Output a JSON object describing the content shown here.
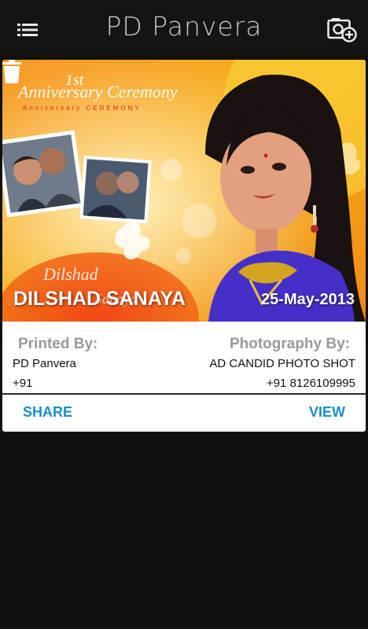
{
  "appbar": {
    "title": "PD Panvera",
    "menu_icon": "hamburger-menu-icon",
    "add_photo_icon": "add-photo-icon"
  },
  "card": {
    "image": {
      "ceremony_title": "1st Anniversary Ceremony",
      "ceremony_subtitle": "Anniversary CEREMONY",
      "couple_script": "Dilshad weds Sanaya",
      "name_overlay": "DILSHAD SANAYA",
      "date_overlay": "25-May-2013",
      "delete_icon": "trash-icon"
    },
    "printed_by": {
      "label": "Printed By:",
      "name": "PD Panvera",
      "phone": "+91"
    },
    "photography_by": {
      "label": "Photography By:",
      "name": "AD CANDID PHOTO SHOT",
      "phone": "+91 8126109995"
    },
    "actions": {
      "share_label": "SHARE",
      "view_label": "VIEW"
    }
  },
  "colors": {
    "background": "#111210",
    "accent": "#1a8fc8",
    "label_gray": "#9a9a9a",
    "banner_orange": "#f39a2d",
    "banner_yellow": "#f7c21e"
  }
}
